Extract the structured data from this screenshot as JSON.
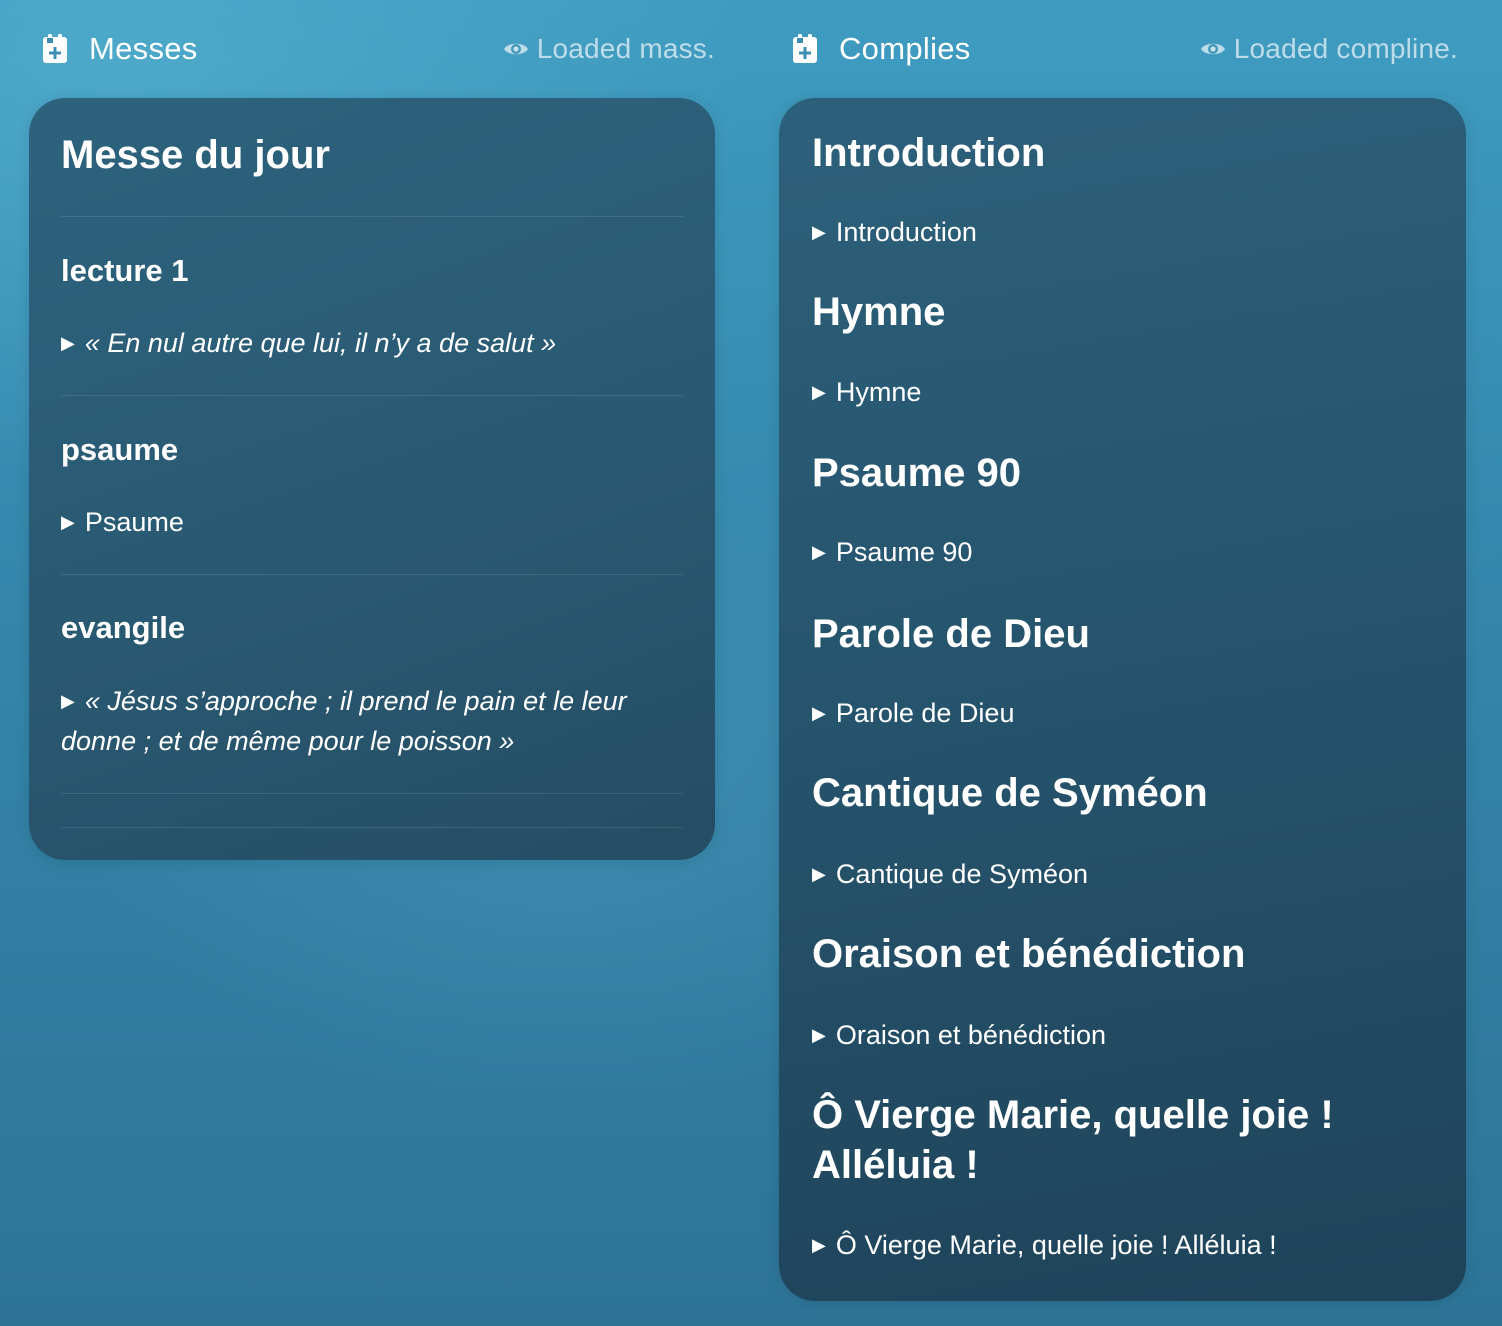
{
  "mass_widget": {
    "title": "Messes",
    "status": "Loaded mass.",
    "card_title": "Messe du jour",
    "sections": [
      {
        "heading": "lecture 1",
        "entry": "« En nul autre que lui, il n’y a de salut »"
      },
      {
        "heading": "psaume",
        "entry": "Psaume"
      },
      {
        "heading": "evangile",
        "entry": "« Jésus s’approche ; il prend le pain et le leur donne ; et de même pour le poisson »"
      }
    ]
  },
  "compline_widget": {
    "title": "Complies",
    "status": "Loaded compline.",
    "sections": [
      {
        "heading": "Introduction",
        "entry": "Introduction"
      },
      {
        "heading": "Hymne",
        "entry": "Hymne"
      },
      {
        "heading": "Psaume 90",
        "entry": "Psaume 90"
      },
      {
        "heading": "Parole de Dieu",
        "entry": "Parole de Dieu"
      },
      {
        "heading": "Cantique de Syméon",
        "entry": "Cantique de Syméon"
      },
      {
        "heading": "Oraison et bénédiction",
        "entry": "Oraison et bénédiction"
      },
      {
        "heading": "Ô Vierge Marie, quelle joie ! Alléluia !",
        "entry": "Ô Vierge Marie, quelle joie ! Alléluia !"
      }
    ]
  },
  "icons": {
    "app": "calendar-plus-icon",
    "status": "eye-icon",
    "disclosure": "triangle-right-icon"
  },
  "colors": {
    "text": "#ffffff",
    "status_text": "#e1eef5",
    "card": "#2c607a",
    "background": "#3486ab"
  }
}
